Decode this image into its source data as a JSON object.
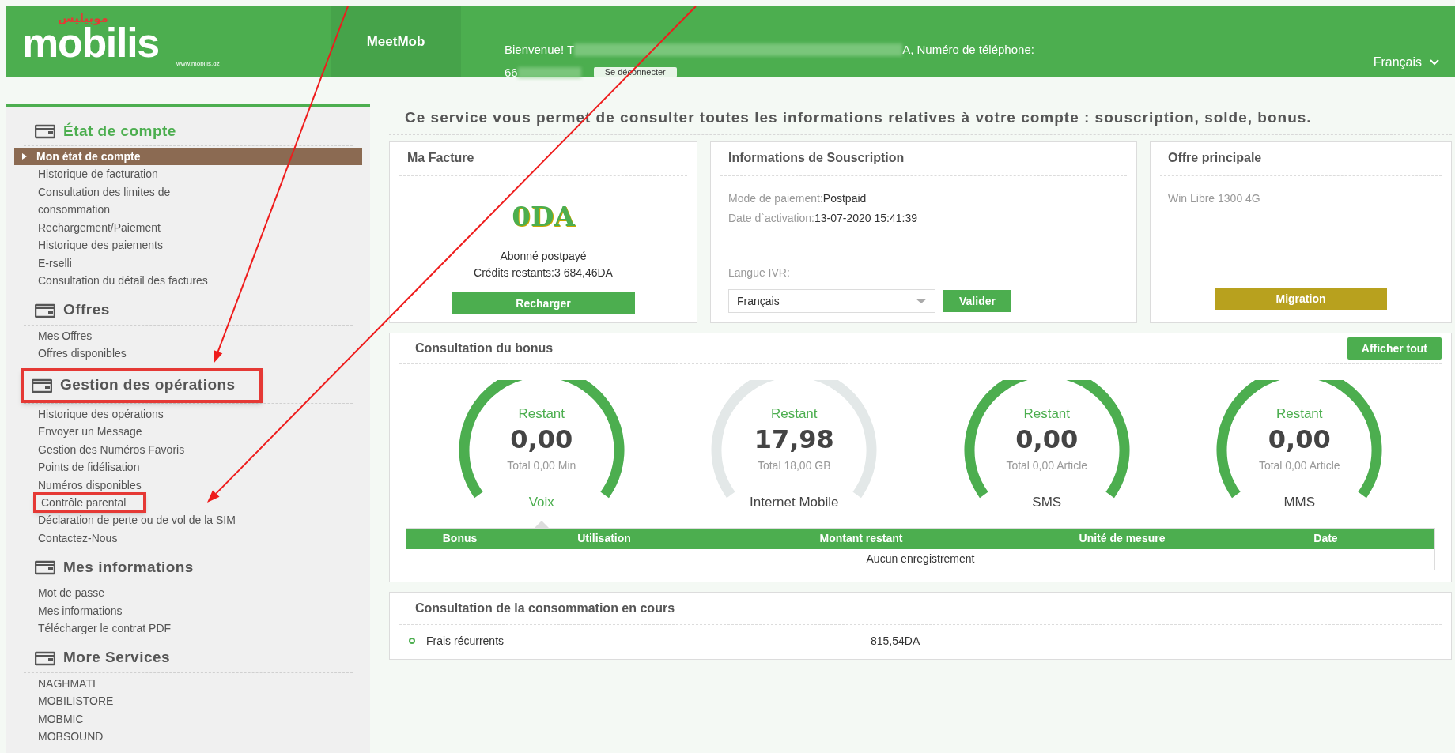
{
  "header": {
    "logo": {
      "arabic": "موبيليس",
      "name": "mobilis",
      "url": "www.mobilis.dz"
    },
    "app_name": "MeetMob",
    "welcome_start": "Bienvenue! T",
    "welcome_end": "A, Numéro de téléphone:",
    "phone_start": "66",
    "logout": "Se déconnecter",
    "language": "Français"
  },
  "sidebar": {
    "sections": [
      {
        "title": "État de compte",
        "active": true,
        "highlighted": false,
        "items": [
          {
            "label": "Mon état de compte",
            "selected": true,
            "highlighted": false
          },
          {
            "label": "Historique de facturation",
            "selected": false,
            "highlighted": false
          },
          {
            "label": "Consultation des limites de\nconsommation",
            "selected": false,
            "highlighted": false
          },
          {
            "label": "Rechargement/Paiement",
            "selected": false,
            "highlighted": false
          },
          {
            "label": "Historique des paiements",
            "selected": false,
            "highlighted": false
          },
          {
            "label": "E-rselli",
            "selected": false,
            "highlighted": false
          },
          {
            "label": "Consultation du détail des factures",
            "selected": false,
            "highlighted": false
          }
        ]
      },
      {
        "title": "Offres",
        "active": false,
        "highlighted": false,
        "items": [
          {
            "label": "Mes Offres",
            "selected": false,
            "highlighted": false
          },
          {
            "label": "Offres disponibles",
            "selected": false,
            "highlighted": false
          }
        ]
      },
      {
        "title": "Gestion des opérations",
        "active": false,
        "highlighted": true,
        "items": [
          {
            "label": "Historique des opérations",
            "selected": false,
            "highlighted": false
          },
          {
            "label": "Envoyer un Message",
            "selected": false,
            "highlighted": false
          },
          {
            "label": "Gestion des Numéros Favoris",
            "selected": false,
            "highlighted": false
          },
          {
            "label": "Points de fidélisation",
            "selected": false,
            "highlighted": false
          },
          {
            "label": "Numéros disponibles",
            "selected": false,
            "highlighted": false
          },
          {
            "label": "Contrôle parental",
            "selected": false,
            "highlighted": true
          },
          {
            "label": "Déclaration de perte ou de vol de la SIM",
            "selected": false,
            "highlighted": false
          },
          {
            "label": "Contactez-Nous",
            "selected": false,
            "highlighted": false
          }
        ]
      },
      {
        "title": "Mes informations",
        "active": false,
        "highlighted": false,
        "items": [
          {
            "label": "Mot de passe",
            "selected": false,
            "highlighted": false
          },
          {
            "label": "Mes informations",
            "selected": false,
            "highlighted": false
          },
          {
            "label": "Télécharger le contrat PDF",
            "selected": false,
            "highlighted": false
          }
        ]
      },
      {
        "title": "More Services",
        "active": false,
        "highlighted": false,
        "items": [
          {
            "label": "NAGHMATI",
            "selected": false,
            "highlighted": false
          },
          {
            "label": "MOBILISTORE",
            "selected": false,
            "highlighted": false
          },
          {
            "label": "MOBMIC",
            "selected": false,
            "highlighted": false
          },
          {
            "label": "MOBSOUND",
            "selected": false,
            "highlighted": false
          }
        ]
      }
    ]
  },
  "intro": "Ce service vous permet de consulter toutes les informations relatives à votre compte : souscription, solde, bonus.",
  "invoice": {
    "title": "Ma Facture",
    "amount": "0DA",
    "status": "Abonné postpayé",
    "credits": "Crédits restants:3 684,46DA",
    "button": "Recharger"
  },
  "subscription": {
    "title": "Informations de Souscription",
    "lines": [
      {
        "label": "Mode de paiement:",
        "value": "Postpaid"
      },
      {
        "label": "Date d`activation:",
        "value": "13-07-2020 15:41:39"
      }
    ],
    "ivr_label": "Langue IVR:",
    "ivr_value": "Français",
    "button": "Valider"
  },
  "offer": {
    "title": "Offre principale",
    "name": "Win Libre 1300 4G",
    "button": "Migration"
  },
  "bonus": {
    "title": "Consultation du bonus",
    "button": "Afficher tout",
    "gauges": [
      {
        "caption": "Restant",
        "value": "0,00",
        "total": "Total 0,00 Min",
        "name": "Voix",
        "selected": true
      },
      {
        "caption": "Restant",
        "value": "17,98",
        "total": "Total 18,00 GB",
        "name": "Internet Mobile",
        "selected": false
      },
      {
        "caption": "Restant",
        "value": "0,00",
        "total": "Total 0,00 Article",
        "name": "SMS",
        "selected": false
      },
      {
        "caption": "Restant",
        "value": "0,00",
        "total": "Total 0,00 Article",
        "name": "MMS",
        "selected": false
      }
    ],
    "table": {
      "columns": [
        "Bonus",
        "Utilisation",
        "Montant restant",
        "Unité de mesure",
        "Date"
      ],
      "empty": "Aucun enregistrement"
    }
  },
  "consumption": {
    "title": "Consultation de la consommation en cours",
    "rows": [
      {
        "label": "Frais récurrents",
        "value": "815,54DA"
      }
    ]
  }
}
